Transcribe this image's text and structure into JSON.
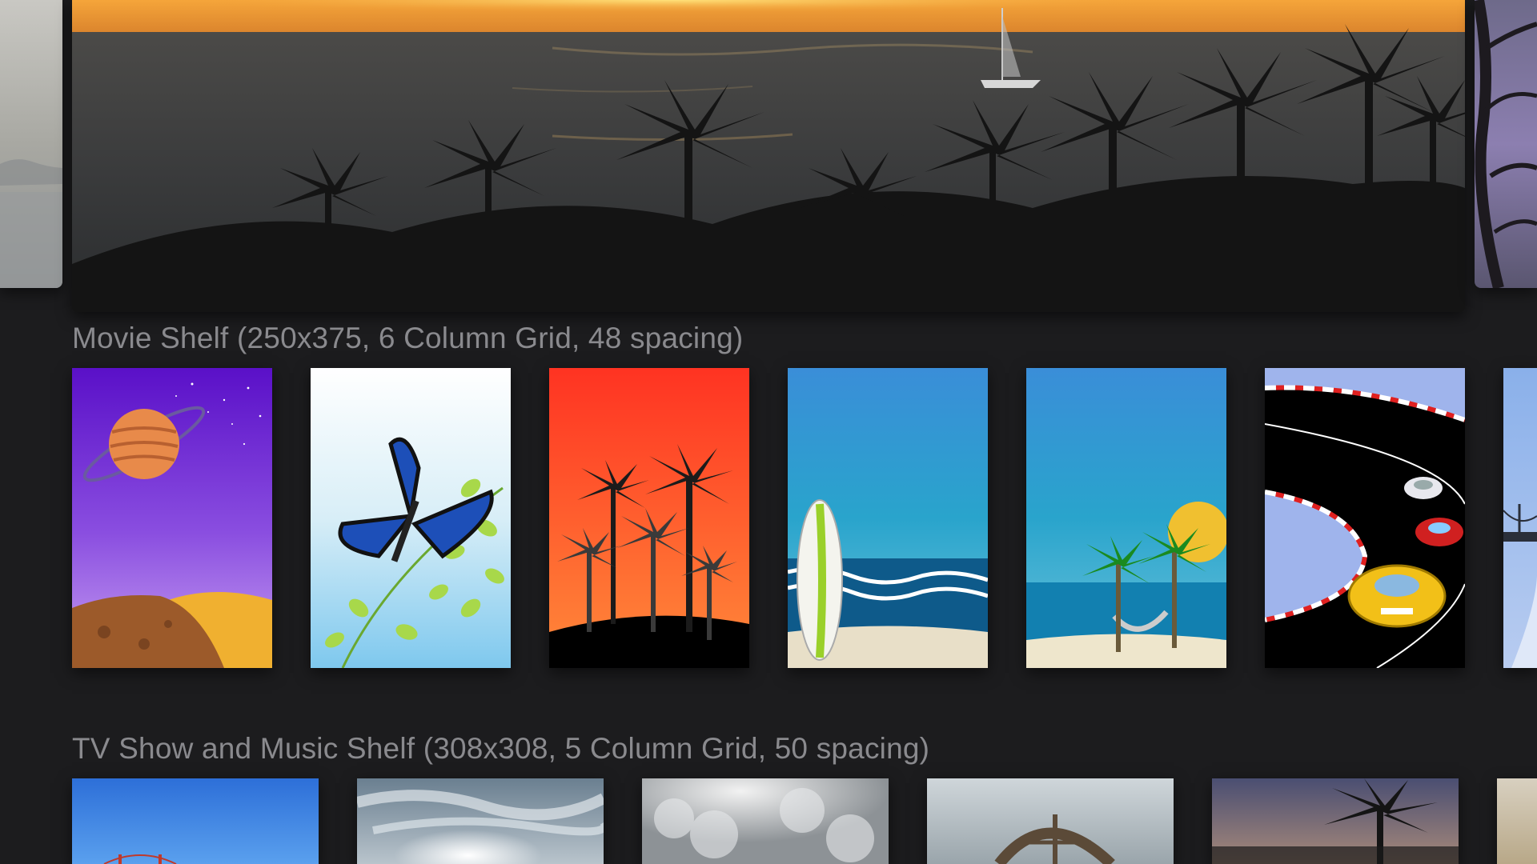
{
  "hero": {
    "left_partial": "mist-landscape",
    "main": "sunset-ocean-palms",
    "right_partial": "dusk-tree-branches"
  },
  "movie_shelf": {
    "title": "Movie Shelf (250x375, 6 Column Grid, 48 spacing)",
    "posters": [
      {
        "name": "planet-poster",
        "scene": "planet"
      },
      {
        "name": "butterfly-poster",
        "scene": "butterfly"
      },
      {
        "name": "palm-sunset-poster",
        "scene": "palms"
      },
      {
        "name": "surfboard-poster",
        "scene": "surf"
      },
      {
        "name": "hammock-poster",
        "scene": "hammock"
      },
      {
        "name": "race-cars-poster",
        "scene": "race"
      },
      {
        "name": "bridge-poster-partial",
        "scene": "bridge"
      }
    ]
  },
  "tv_shelf": {
    "title": "TV Show and Music Shelf (308x308, 5 Column Grid, 50 spacing)",
    "items": [
      {
        "name": "golden-gate-item",
        "scene": "bridge-sky"
      },
      {
        "name": "sun-clouds-item",
        "scene": "sun-clouds"
      },
      {
        "name": "cloudy-sky-item",
        "scene": "clouds"
      },
      {
        "name": "water-wheel-item",
        "scene": "wheel"
      },
      {
        "name": "palm-dusk-item",
        "scene": "palm-dusk"
      },
      {
        "name": "partial-item",
        "scene": "partial"
      }
    ]
  },
  "colors": {
    "background": "#1c1c1e",
    "title_text": "#8a8a8e"
  }
}
